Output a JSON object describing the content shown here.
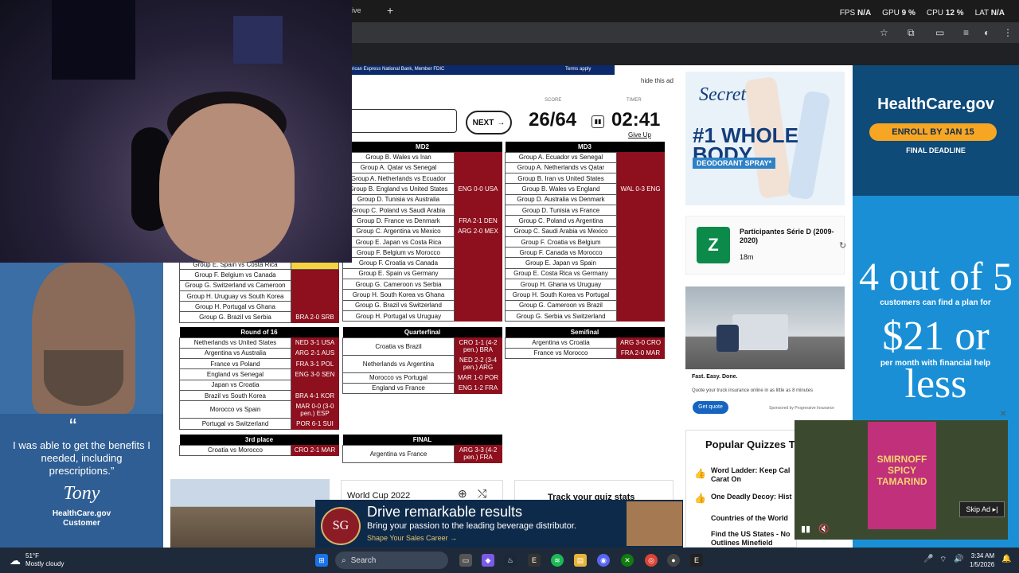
{
  "browser": {
    "tab_fragment": "ive",
    "new_tab": "+",
    "stats": [
      {
        "label": "FPS",
        "value": "N/A"
      },
      {
        "label": "GPU",
        "value": "9 %"
      },
      {
        "label": "CPU",
        "value": "12 %"
      },
      {
        "label": "LAT",
        "value": "N/A"
      }
    ]
  },
  "promo_banner": {
    "text": "rican Express National Bank, Member FDIC",
    "terms": "Terms apply"
  },
  "hide_ad": "hide this ad",
  "quiz": {
    "next_label": "NEXT",
    "score_label": "SCORE",
    "timer_label": "TIMER",
    "score": "26/64",
    "timer": "02:41",
    "give_up": "Give Up",
    "md2": {
      "title": "MD2",
      "rows": [
        [
          "Group B. Wales vs Iran",
          ""
        ],
        [
          "Group A. Qatar vs Senegal",
          ""
        ],
        [
          "Group A. Netherlands vs Ecuador",
          ""
        ],
        [
          "Group B. England vs United States",
          "ENG 0-0 USA"
        ],
        [
          "Group D. Tunisia vs Australia",
          ""
        ],
        [
          "Group C. Poland vs Saudi Arabia",
          ""
        ],
        [
          "Group D. France vs Denmark",
          "FRA 2-1 DEN"
        ],
        [
          "Group C. Argentina vs Mexico",
          "ARG 2-0 MEX"
        ],
        [
          "Group E. Japan vs Costa Rica",
          ""
        ],
        [
          "Group F. Belgium vs Morocco",
          ""
        ],
        [
          "Group F. Croatia vs Canada",
          ""
        ],
        [
          "Group E. Spain vs Germany",
          ""
        ],
        [
          "Group G. Cameroon vs Serbia",
          ""
        ],
        [
          "Group H. South Korea vs Ghana",
          ""
        ],
        [
          "Group G. Brazil vs Switzerland",
          ""
        ],
        [
          "Group H. Portugal vs Uruguay",
          ""
        ]
      ]
    },
    "md3": {
      "title": "MD3",
      "rows": [
        [
          "Group A. Ecuador vs Senegal",
          ""
        ],
        [
          "Group A. Netherlands vs Qatar",
          ""
        ],
        [
          "Group B. Iran vs United States",
          ""
        ],
        [
          "Group B. Wales vs England",
          "WAL 0-3 ENG"
        ],
        [
          "Group D. Australia vs Denmark",
          ""
        ],
        [
          "Group D. Tunisia vs France",
          ""
        ],
        [
          "Group C. Poland vs Argentina",
          ""
        ],
        [
          "Group C. Saudi Arabia vs Mexico",
          ""
        ],
        [
          "Group F. Croatia vs Belgium",
          ""
        ],
        [
          "Group F. Canada vs Morocco",
          ""
        ],
        [
          "Group E. Japan vs Spain",
          ""
        ],
        [
          "Group E. Costa Rica vs Germany",
          ""
        ],
        [
          "Group H. Ghana vs Uruguay",
          ""
        ],
        [
          "Group H. South Korea vs Portugal",
          ""
        ],
        [
          "Group G. Cameroon vs Brazil",
          ""
        ],
        [
          "Group G. Serbia vs Switzerland",
          ""
        ]
      ]
    },
    "md1_tail": {
      "rows": [
        [
          "Group E. Spain vs Costa Rica",
          ""
        ],
        [
          "Group F. Belgium vs Canada",
          ""
        ],
        [
          "Group G. Switzerland vs Cameroon",
          ""
        ],
        [
          "Group H. Uruguay vs South Korea",
          ""
        ],
        [
          "Group H. Portugal vs Ghana",
          ""
        ],
        [
          "Group G. Brazil vs Serbia",
          "BRA 2-0 SRB"
        ]
      ]
    },
    "r16": {
      "title": "Round of 16",
      "rows": [
        [
          "Netherlands vs United States",
          "NED 3-1 USA"
        ],
        [
          "Argentina vs Australia",
          "ARG 2-1 AUS"
        ],
        [
          "France vs Poland",
          "FRA 3-1 POL"
        ],
        [
          "England vs Senegal",
          "ENG 3-0 SEN"
        ],
        [
          "Japan vs Croatia",
          ""
        ],
        [
          "Brazil vs South Korea",
          "BRA 4-1 KOR"
        ],
        [
          "Morocco vs Spain",
          "MAR 0-0 (3-0 pen.) ESP"
        ],
        [
          "Portugal vs Switzerland",
          "POR 6-1 SUI"
        ]
      ]
    },
    "qf": {
      "title": "Quarterfinal",
      "rows": [
        [
          "Croatia vs Brazil",
          "CRO 1-1 (4-2 pen.) BRA"
        ],
        [
          "Netherlands vs Argentina",
          "NED 2-2 (3-4 pen.) ARG"
        ],
        [
          "Morocco vs Portugal",
          "MAR 1-0 POR"
        ],
        [
          "England vs France",
          "ENG 1-2 FRA"
        ]
      ]
    },
    "sf": {
      "title": "Semifinal",
      "rows": [
        [
          "Argentina vs Croatia",
          "ARG 3-0 CRO"
        ],
        [
          "France vs Morocco",
          "FRA 2-0 MAR"
        ]
      ]
    },
    "third": {
      "title": "3rd place",
      "rows": [
        [
          "Croatia vs Morocco",
          "CRO 2-1 MAR"
        ]
      ]
    },
    "final": {
      "title": "FINAL",
      "rows": [
        [
          "Argentina vs France",
          "ARG 3-3 (4-2 pen.) FRA"
        ]
      ]
    }
  },
  "left_ad": {
    "quote": "I was able to get the benefits I needed, including prescriptions.”",
    "name": "Tony",
    "source": "HealthCare.gov",
    "role": "Customer"
  },
  "secret_ad": {
    "logo": "Secret",
    "headline1": "#1 WHOLE",
    "headline2": "BODY",
    "sub": "DEODORANT SPRAY*"
  },
  "yt_card": {
    "logo": "Z",
    "title": "Participantes Série D (2009-2020)",
    "meta": "18m"
  },
  "truck_ad": {
    "tagline": "Fast. Easy. Done.",
    "body": "Quote your truck insurance online in as little as 8 minutes",
    "cta": "Get quote",
    "sponsor": "Sponsored by Progressive Insurance"
  },
  "popular": {
    "title": "Popular Quizzes To",
    "items": [
      "Word Ladder: Keep Cal Carat On",
      "One Deadly Decoy: Hist",
      "Countries of the World",
      "Find the US States - No Outlines Minefield"
    ]
  },
  "healthcare_ad": {
    "logo": "HealthCare.gov",
    "button": "ENROLL BY JAN 15",
    "deadline": "FINAL DEADLINE",
    "big1": "4 out of 5",
    "find": "customers can find a plan for",
    "big2": "$21 or less",
    "month": "per month with financial help"
  },
  "video_ad": {
    "can_text": "SMIRNOFF SPICY TAMARIND",
    "skip": "Skip Ad"
  },
  "world_cup_card": {
    "title": "World Cup 2022"
  },
  "track_card": {
    "title": "Track your quiz stats"
  },
  "beverage_ad": {
    "logo": "SG",
    "headline": "Drive remarkable results",
    "sub": "Bring your passion to the leading beverage distributor.",
    "link": "Shape Your Sales Career →"
  },
  "taskbar": {
    "temp": "51°F",
    "weather": "Mostly cloudy",
    "search": "Search",
    "time": "3:34 AM",
    "date": "1/5/2026"
  },
  "colors": {
    "result_red": "#8e0f1d",
    "header_black": "#000000",
    "healthcare_blue": "#1a8fd6"
  }
}
